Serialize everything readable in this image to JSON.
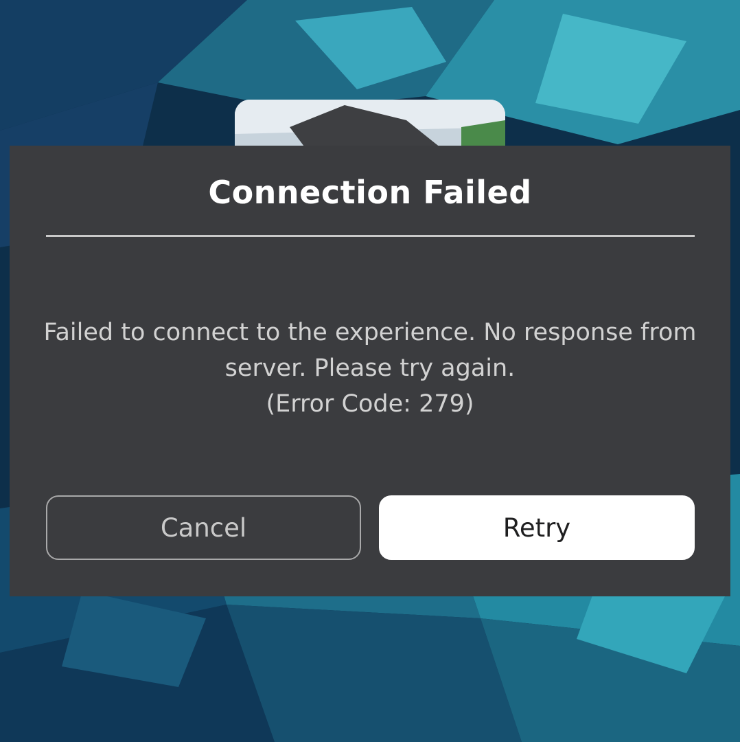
{
  "dialog": {
    "title": "Connection Failed",
    "message_line1": "Failed to connect to the experience. No response from",
    "message_line2": "server. Please try again.",
    "error_code": "(Error Code: 279)"
  },
  "buttons": {
    "cancel_label": "Cancel",
    "retry_label": "Retry"
  },
  "colors": {
    "dialog_background": "#3b3c3f",
    "title_text": "#ffffff",
    "body_text": "#d2d2d2",
    "retry_background": "#ffffff",
    "cancel_border": "#a9a9aa",
    "backdrop_accent": "#2aa9b8"
  }
}
